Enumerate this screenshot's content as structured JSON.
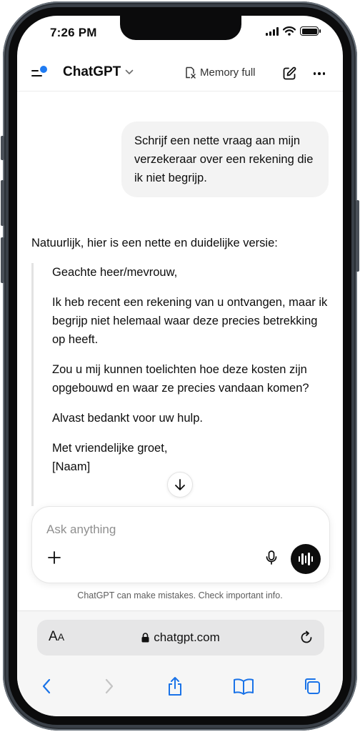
{
  "status_bar": {
    "time": "7:26 PM"
  },
  "header": {
    "title": "ChatGPT",
    "memory_label": "Memory full",
    "menu_icon": "sidebar-toggle-icon",
    "edit_icon": "new-chat-icon",
    "more_icon": "more-icon",
    "accent": "#1f7bf2"
  },
  "conversation": {
    "user_message": "Schrijf een nette vraag aan mijn verzekeraar over een rekening die ik niet begrijp.",
    "assistant_intro": "Natuurlijk, hier is een nette en duidelijke versie:",
    "letter": [
      "Geachte heer/mevrouw,",
      "Ik heb recent een rekening van u ontvangen, maar ik begrijp niet helemaal waar deze precies betrekking op heeft.",
      "Zou u mij kunnen toelichten hoe deze kosten zijn opgebouwd en waar ze precies vandaan komen?",
      "Alvast bedankt voor uw hulp.",
      "Met vriendelijke groet,",
      "[Naam]"
    ]
  },
  "composer": {
    "placeholder": "Ask anything",
    "disclaimer": "ChatGPT can make mistakes. Check important info."
  },
  "browser": {
    "aa_label_big": "A",
    "aa_label_small": "A",
    "url": "chatgpt.com",
    "toolbar": [
      "back-icon",
      "forward-icon",
      "share-icon",
      "bookmarks-icon",
      "tabs-icon"
    ],
    "toolbar_color": "#1a73e8"
  }
}
